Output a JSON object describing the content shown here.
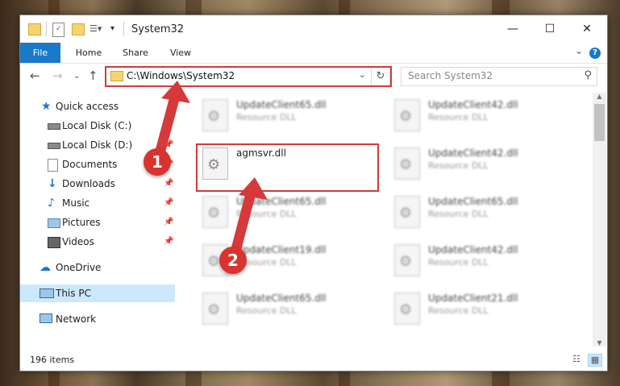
{
  "window": {
    "title": "System32"
  },
  "ribbon": {
    "tabs": [
      "File",
      "Home",
      "Share",
      "View"
    ]
  },
  "address": {
    "path": "C:\\Windows\\System32"
  },
  "search": {
    "placeholder": "Search System32"
  },
  "nav_pane": {
    "items": [
      {
        "label": "Quick access",
        "icon": "star-icon",
        "pinned": false
      },
      {
        "label": "Local Disk (C:)",
        "icon": "drive-icon",
        "pinned": true
      },
      {
        "label": "Local Disk (D:)",
        "icon": "drive-icon",
        "pinned": true
      },
      {
        "label": "Documents",
        "icon": "documents-icon",
        "pinned": true
      },
      {
        "label": "Downloads",
        "icon": "downloads-icon",
        "pinned": true
      },
      {
        "label": "Music",
        "icon": "music-icon",
        "pinned": true
      },
      {
        "label": "Pictures",
        "icon": "pictures-icon",
        "pinned": true
      },
      {
        "label": "Videos",
        "icon": "videos-icon",
        "pinned": true
      },
      {
        "label": "OneDrive",
        "icon": "cloud-icon",
        "pinned": false
      },
      {
        "label": "This PC",
        "icon": "computer-icon",
        "pinned": false
      },
      {
        "label": "Network",
        "icon": "network-icon",
        "pinned": false
      }
    ]
  },
  "files": [
    {
      "name": "UpdateClient65.dll",
      "type": "Resource DLL",
      "blurred": true
    },
    {
      "name": "UpdateClient42.dll",
      "type": "Resource DLL",
      "blurred": true
    },
    {
      "name": "agmsvr.dll",
      "type": "",
      "blurred": false
    },
    {
      "name": "UpdateClient42.dll",
      "type": "Resource DLL",
      "blurred": true
    },
    {
      "name": "UpdateClient65.dll",
      "type": "Resource DLL",
      "blurred": true
    },
    {
      "name": "UpdateClient65.dll",
      "type": "Resource DLL",
      "blurred": true
    },
    {
      "name": "UpdateClient19.dll",
      "type": "Resource DLL",
      "blurred": true
    },
    {
      "name": "UpdateClient42.dll",
      "type": "Resource DLL",
      "blurred": true
    },
    {
      "name": "UpdateClient65.dll",
      "type": "Resource DLL",
      "blurred": true
    },
    {
      "name": "UpdateClient21.dll",
      "type": "Resource DLL",
      "blurred": true
    }
  ],
  "status": {
    "count": "196 items"
  },
  "annotations": {
    "step1": "1",
    "step2": "2",
    "color": "#d6393a"
  }
}
